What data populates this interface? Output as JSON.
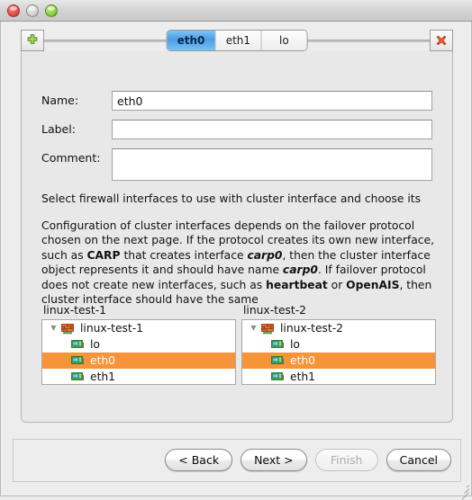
{
  "window": {
    "controls": {
      "close_label": "close",
      "minimize_label": "minimize",
      "zoom_label": "zoom"
    }
  },
  "toolbar": {
    "add_tab_label": "+",
    "delete_tab_label": "x"
  },
  "tabs": [
    {
      "label": "eth0",
      "selected": true
    },
    {
      "label": "eth1",
      "selected": false
    },
    {
      "label": "lo",
      "selected": false
    }
  ],
  "form": {
    "name": {
      "label": "Name:",
      "value": "eth0",
      "placeholder": ""
    },
    "label": {
      "label": "Label:",
      "value": "",
      "placeholder": ""
    },
    "comment": {
      "label": "Comment:",
      "value": "",
      "placeholder": ""
    }
  },
  "help": {
    "lead": "Select firewall interfaces to use with cluster interface and choose its",
    "body_parts": [
      {
        "text": "Configuration of cluster interfaces depends on the failover protocol chosen on the next page. If the protocol creates its own new interface, such as ",
        "style": "normal"
      },
      {
        "text": "CARP",
        "style": "bold"
      },
      {
        "text": " that creates interface ",
        "style": "normal"
      },
      {
        "text": "carp0",
        "style": "bold-italic"
      },
      {
        "text": ", then the cluster interface object represents it and should have name ",
        "style": "normal"
      },
      {
        "text": "carp0",
        "style": "bold-italic"
      },
      {
        "text": ". If failover protocol does not create new interfaces, such as ",
        "style": "normal"
      },
      {
        "text": "heartbeat",
        "style": "bold"
      },
      {
        "text": " or ",
        "style": "normal"
      },
      {
        "text": "OpenAIS",
        "style": "bold"
      },
      {
        "text": ", then cluster interface should have the same",
        "style": "normal"
      }
    ]
  },
  "trees": [
    {
      "header": "linux-test-1",
      "root": {
        "label": "linux-test-1",
        "icon": "firewall-icon",
        "expanded": true
      },
      "children": [
        {
          "label": "lo",
          "icon": "network-interface-icon",
          "selected": false
        },
        {
          "label": "eth0",
          "icon": "network-interface-icon",
          "selected": true
        },
        {
          "label": "eth1",
          "icon": "network-interface-icon",
          "selected": false
        }
      ]
    },
    {
      "header": "linux-test-2",
      "root": {
        "label": "linux-test-2",
        "icon": "firewall-icon",
        "expanded": true
      },
      "children": [
        {
          "label": "lo",
          "icon": "network-interface-icon",
          "selected": false
        },
        {
          "label": "eth0",
          "icon": "network-interface-icon",
          "selected": true
        },
        {
          "label": "eth1",
          "icon": "network-interface-icon",
          "selected": false
        }
      ]
    }
  ],
  "footer": {
    "back": "< Back",
    "next": "Next >",
    "finish": "Finish",
    "cancel": "Cancel"
  },
  "colors": {
    "selection_orange": "#f79439",
    "tab_selected_blue": "#4c9ee6",
    "window_background": "#ededed",
    "panel_background": "#e8e8e8",
    "add_icon_green": "#7ab648",
    "delete_icon_red": "#d9451f",
    "firewall_icon_orange": "#d4561f"
  }
}
